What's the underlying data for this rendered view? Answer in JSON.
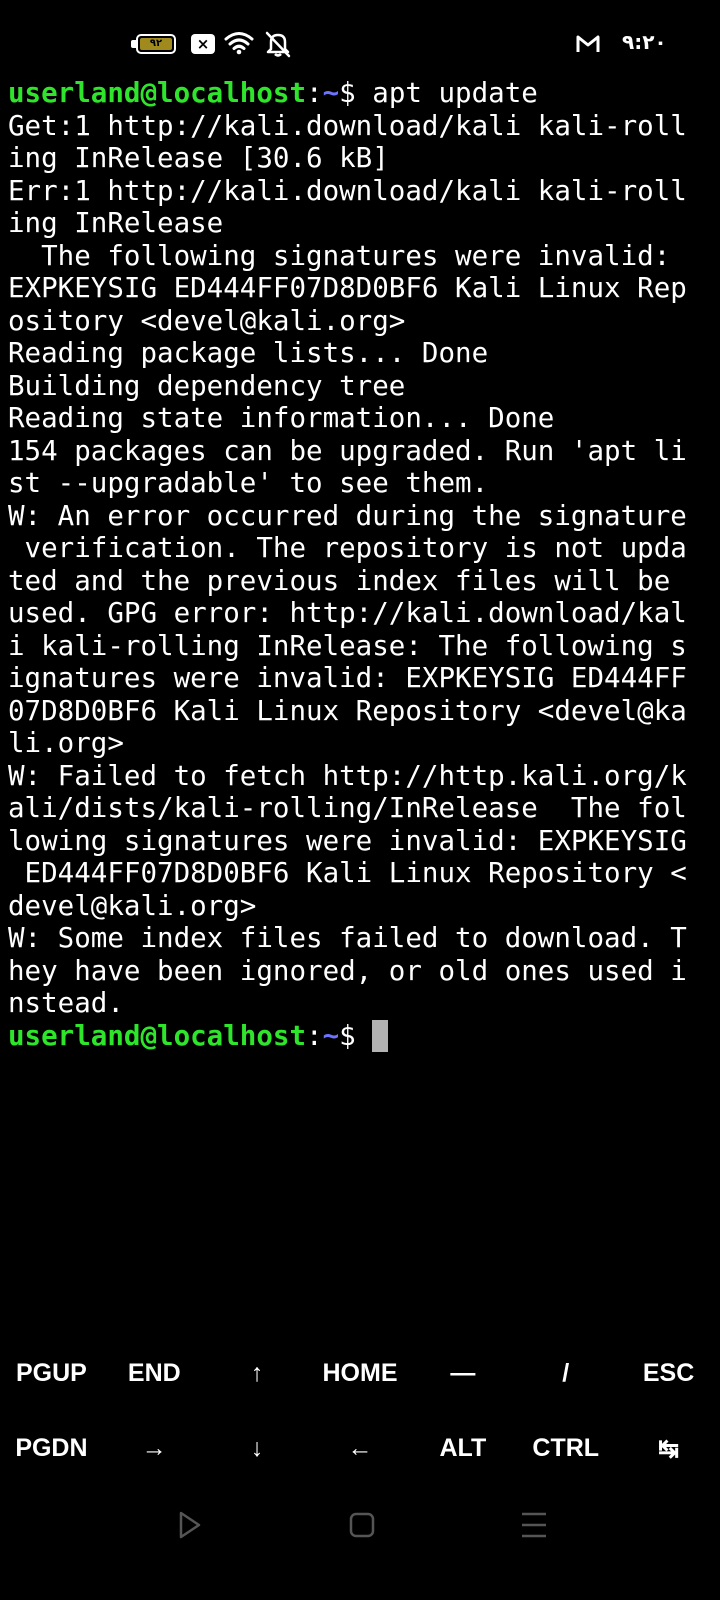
{
  "status_bar": {
    "battery_level": "۹۲",
    "sim_status": "×",
    "clock": "۹:۲۰",
    "icons": [
      "battery-icon",
      "no-sim-icon",
      "wifi-icon",
      "notifications-muted-icon",
      "gmail-icon"
    ]
  },
  "terminal": {
    "prompt": {
      "user_host": "userland@localhost",
      "colon": ":",
      "path": "~",
      "symbol": "$ "
    },
    "command": "apt update",
    "output_lines": [
      "Get:1 http://kali.download/kali kali-roll",
      "ing InRelease [30.6 kB]",
      "Err:1 http://kali.download/kali kali-roll",
      "ing InRelease",
      "  The following signatures were invalid:",
      "EXPKEYSIG ED444FF07D8D0BF6 Kali Linux Rep",
      "ository <devel@kali.org>",
      "Reading package lists... Done",
      "Building dependency tree",
      "Reading state information... Done",
      "154 packages can be upgraded. Run 'apt li",
      "st --upgradable' to see them.",
      "W: An error occurred during the signature",
      " verification. The repository is not upda",
      "ted and the previous index files will be",
      "used. GPG error: http://kali.download/kal",
      "i kali-rolling InRelease: The following s",
      "ignatures were invalid: EXPKEYSIG ED444FF",
      "07D8D0BF6 Kali Linux Repository <devel@ka",
      "li.org>",
      "W: Failed to fetch http://http.kali.org/k",
      "ali/dists/kali-rolling/InRelease  The fol",
      "lowing signatures were invalid: EXPKEYSIG",
      " ED444FF07D8D0BF6 Kali Linux Repository <",
      "devel@kali.org>",
      "W: Some index files failed to download. T",
      "hey have been ignored, or old ones used i",
      "nstead."
    ]
  },
  "extra_keys": {
    "row1": [
      "PGUP",
      "END",
      "↑",
      "HOME",
      "—",
      "/",
      "ESC"
    ],
    "row2": [
      "PGDN",
      "→",
      "↓",
      "←",
      "ALT",
      "CTRL",
      "↹"
    ]
  },
  "nav_bar": {
    "icons": [
      "back-icon",
      "home-icon",
      "recents-icon"
    ]
  },
  "colors": {
    "prompt_user": "#2fe52b",
    "prompt_path": "#6b73ff",
    "terminal_text": "#ffffff",
    "background": "#000000",
    "cursor": "#b3b3b3",
    "battery": "#a08a1e"
  }
}
